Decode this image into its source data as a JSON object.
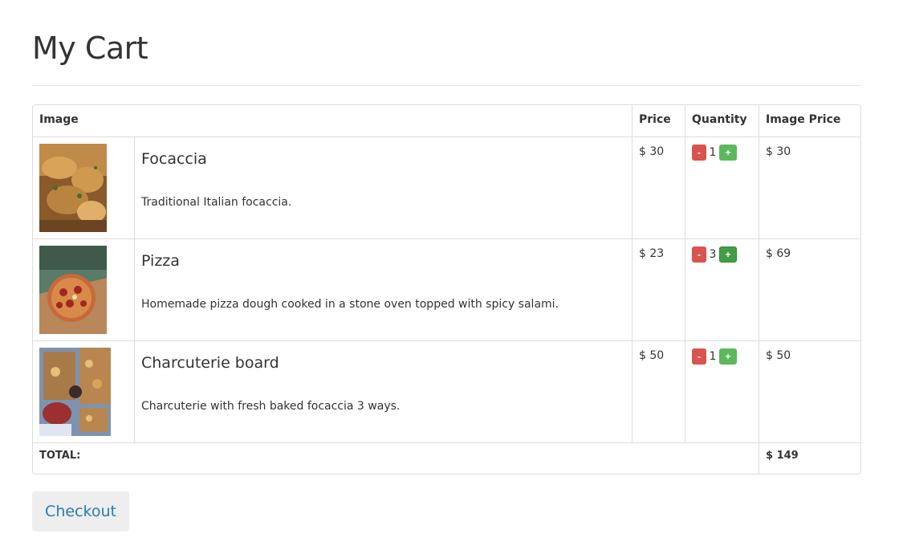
{
  "page": {
    "title": "My Cart"
  },
  "table": {
    "headers": {
      "image": "Image",
      "price": "Price",
      "quantity": "Quantity",
      "line_price": "Image Price"
    },
    "items": [
      {
        "name": "Focaccia",
        "description": "Traditional Italian focaccia.",
        "price": "$ 30",
        "quantity": "1",
        "line_price": "$ 30",
        "minus": "-",
        "plus": "+"
      },
      {
        "name": "Pizza",
        "description": "Homemade pizza dough cooked in a stone oven topped with spicy salami.",
        "price": "$ 23",
        "quantity": "3",
        "line_price": "$ 69",
        "minus": "-",
        "plus": "+"
      },
      {
        "name": "Charcuterie board",
        "description": "Charcuterie with fresh baked focaccia 3 ways.",
        "price": "$ 50",
        "quantity": "1",
        "line_price": "$ 50",
        "minus": "-",
        "plus": "+"
      }
    ],
    "total_label": "TOTAL:",
    "total_value": "$ 149"
  },
  "actions": {
    "checkout_label": "Checkout"
  },
  "colors": {
    "minus": "#d9534f",
    "plus": "#5cb85c",
    "link": "#2a7ab5"
  }
}
